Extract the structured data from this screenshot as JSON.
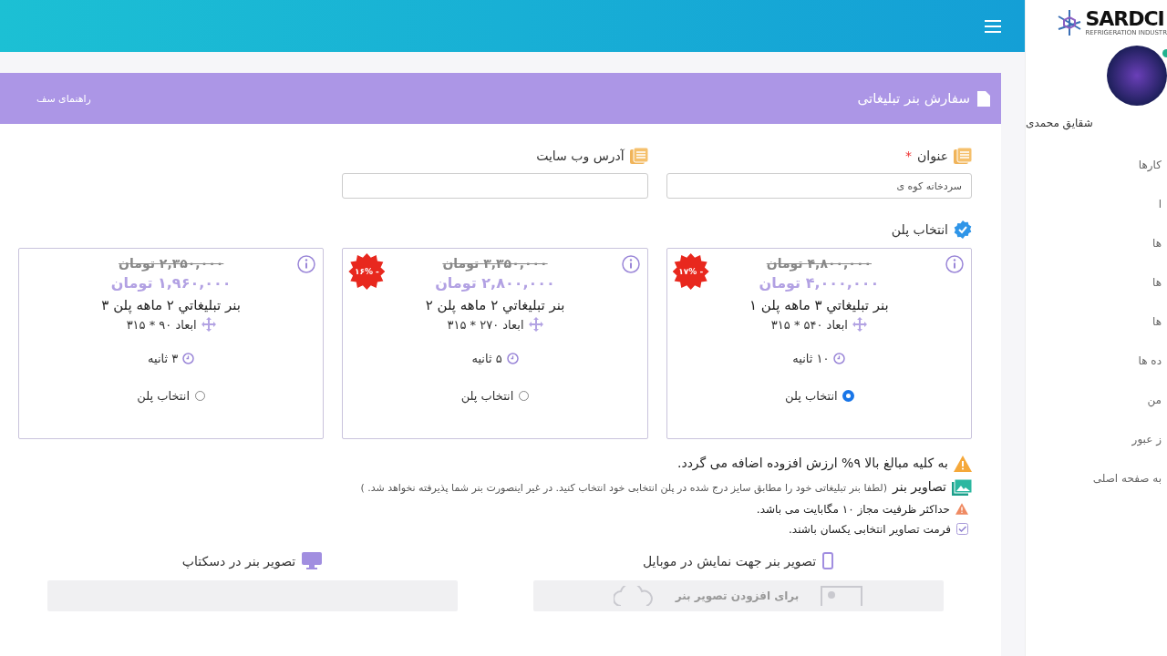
{
  "sidebar": {
    "logo": {
      "name": "SARDCI",
      "tagline": "REFRIGERATION INDUSTR"
    },
    "user": {
      "name": "شقایق محمدی",
      "online": true
    },
    "items": [
      "کارها",
      "ا",
      "ها",
      "ها",
      "ها",
      "ده ها",
      "من",
      "ز عبور",
      "به صفحه اصلی"
    ]
  },
  "panel": {
    "title": "سفارش بنر تبلیغاتی",
    "side_link": "راهنمای سف"
  },
  "fields": [
    {
      "label": "عنوان",
      "required_mark": "*",
      "value": "سردخانه کوه ی"
    },
    {
      "label": "آدرس وب سایت"
    }
  ],
  "plans_heading": "انتخاب پلن",
  "plans": [
    {
      "old_price": "۴,۸۰۰,۰۰۰ تومان",
      "price": "۴,۰۰۰,۰۰۰ تومان",
      "discount": "- ۱۷%",
      "title": "بنر تبليغاتي ۳ ماهه پلن ۱",
      "size": "ابعاد ۵۴۰ * ۳۱۵",
      "duration": "۱۰ ثانیه",
      "choose": "انتخاب پلن",
      "selected": true
    },
    {
      "old_price": "۳,۳۵۰,۰۰۰ تومان",
      "price": "۲,۸۰۰,۰۰۰ تومان",
      "discount": "- ۱۶%",
      "title": "بنر تبليغاتي ۲ ماهه پلن ۲",
      "size": "ابعاد ۲۷۰ * ۳۱۵",
      "duration": "۵ ثانیه",
      "choose": "انتخاب پلن",
      "selected": false
    },
    {
      "old_price": "۲,۳۵۰,۰۰۰ تومان",
      "price": "۱,۹۶۰,۰۰۰ تومان",
      "title": "بنر تبليغاتي ۲ ماهه پلن ۳",
      "size": "ابعاد ۹۰ * ۳۱۵",
      "duration": "۳ ثانیه",
      "choose": "انتخاب پلن",
      "selected": false
    }
  ],
  "notes": [
    {
      "kind": "warning",
      "text": "به کلیه مبالغ بالا ۹% ارزش افزوده اضافه می گردد."
    },
    {
      "kind": "image",
      "text": "تصاویر بنر",
      "hint": "(لطفا بنر تبلیغاتی خود را مطابق سایز درج شده در پلن انتخابی خود انتخاب کنید. در غیر اینصورت بنر شما پذیرفته نخواهد شد. )"
    },
    {
      "kind": "alert",
      "text": "حداکثر ظرفیت مجاز ۱۰ مگابایت می باشد."
    },
    {
      "kind": "check",
      "text": "فرمت تصاویر انتخابی یکسان باشند."
    }
  ],
  "uploads": [
    {
      "kind": "mobile",
      "label": "تصویر بنر جهت نمایش در موبایل",
      "prompt": "برای افزودن تصویر بنر"
    },
    {
      "kind": "desktop",
      "label": "تصویر بنر در دسکتاپ"
    }
  ]
}
